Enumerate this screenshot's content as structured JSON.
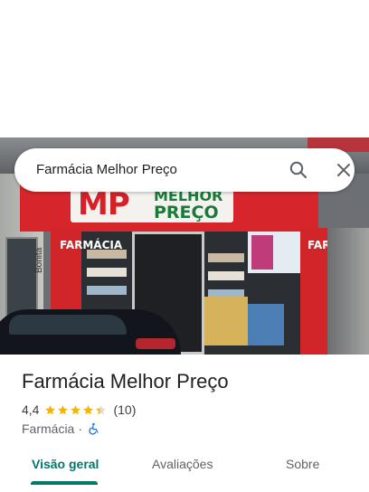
{
  "search": {
    "query": "Farmácia Melhor Preço",
    "search_icon": "search-icon",
    "close_icon": "close-icon"
  },
  "photo": {
    "logo_mp": "MP",
    "logo_line1": "MELHOR",
    "logo_line2": "PREÇO",
    "pillar_left_text": "FARMÁCIA",
    "pillar_right_text": "FARMÁCIA",
    "wall_text": "Bonita"
  },
  "place": {
    "name": "Farmácia Melhor Preço",
    "rating": "4,4",
    "stars": 4.4,
    "reviews": "(10)",
    "category": "Farmácia",
    "separator": "·",
    "accessibility_icon": "wheelchair-icon"
  },
  "tabs": [
    {
      "label": "Visão geral",
      "active": true
    },
    {
      "label": "Avaliações",
      "active": false
    },
    {
      "label": "Sobre",
      "active": false
    }
  ],
  "colors": {
    "accent": "#00796b",
    "star": "#f4b400",
    "brand_red": "#d1252a"
  }
}
